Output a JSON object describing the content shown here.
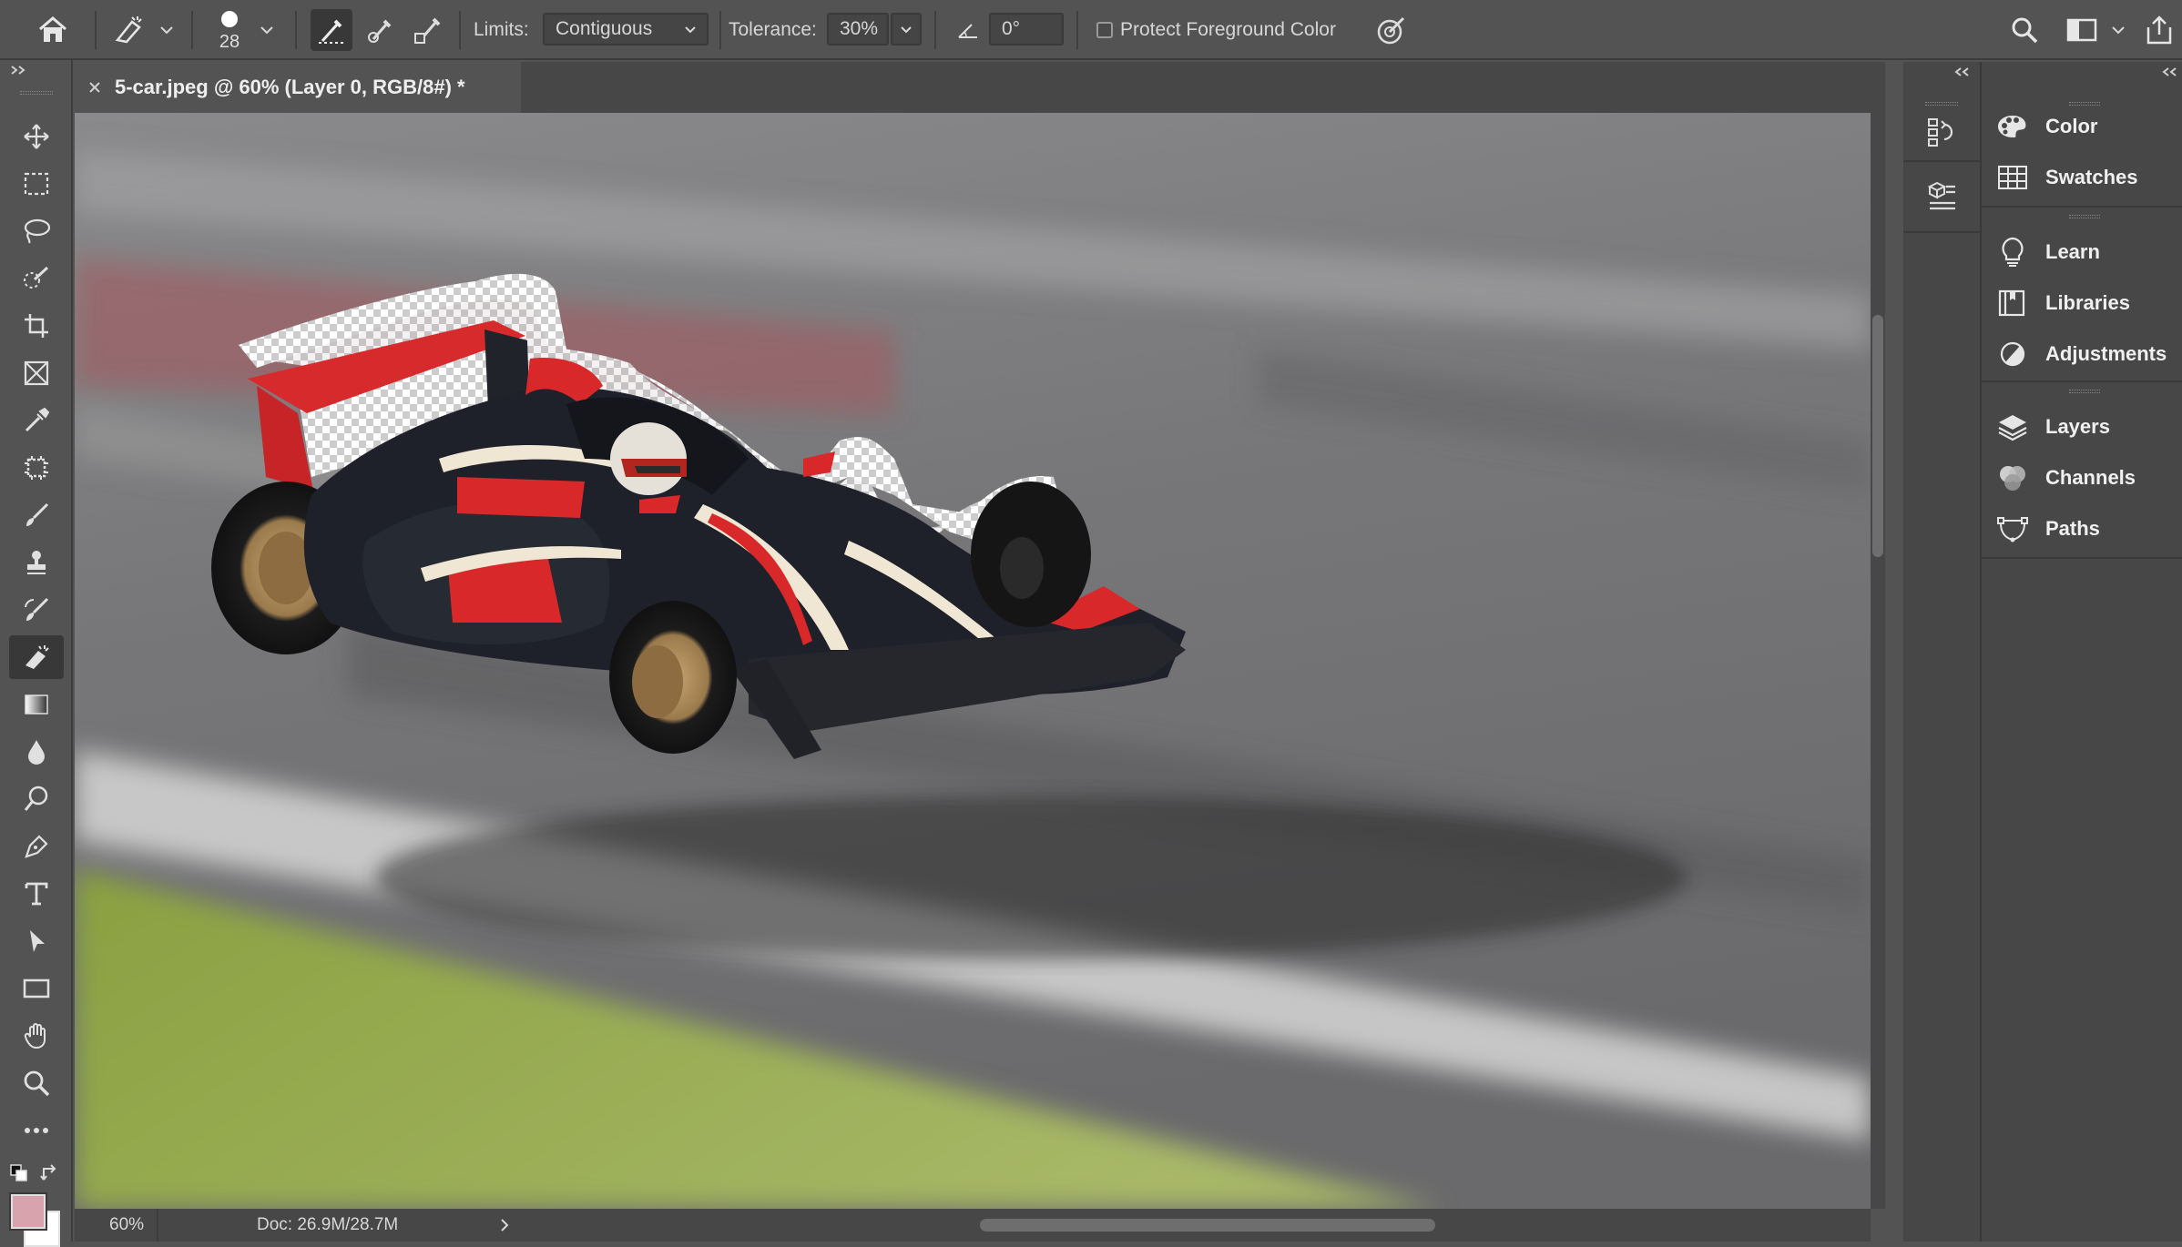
{
  "options_bar": {
    "brush_size": "28",
    "limits_label": "Limits:",
    "limits_value": "Contiguous",
    "tolerance_label": "Tolerance:",
    "tolerance_value": "30%",
    "angle_value": "0°",
    "protect_label": "Protect Foreground Color",
    "protect_checked": false,
    "icons": [
      "home-icon",
      "background-eraser-icon",
      "brush-preset-icon",
      "sampling-continuous-icon",
      "sampling-once-icon",
      "sampling-background-swatch-icon",
      "angle-icon",
      "pressure-icon",
      "search-icon",
      "workspace-icon",
      "share-icon"
    ]
  },
  "document": {
    "tab_title": "5-car.jpeg @ 60% (Layer 0, RGB/8#) *",
    "zoom": "60%",
    "doc_info": "Doc: 26.9M/28.7M"
  },
  "toolbar": {
    "tools": [
      "move-tool",
      "marquee-tool",
      "lasso-tool",
      "quick-selection-tool",
      "crop-tool",
      "frame-tool",
      "eyedropper-tool",
      "patch-tool",
      "brush-tool",
      "clone-stamp-tool",
      "history-brush-tool",
      "background-eraser-tool",
      "gradient-tool",
      "blur-tool",
      "dodge-tool",
      "pen-tool",
      "type-tool",
      "path-selection-tool",
      "rectangle-tool",
      "hand-tool",
      "zoom-tool",
      "more-tools"
    ],
    "active_tool": "background-eraser-tool",
    "foreground_color": "#d9a3ad",
    "background_color": "#ffffff"
  },
  "panels": {
    "groups": [
      [
        {
          "label": "Color",
          "icon": "color-palette-icon"
        },
        {
          "label": "Swatches",
          "icon": "swatches-grid-icon"
        }
      ],
      [
        {
          "label": "Learn",
          "icon": "lightbulb-icon"
        },
        {
          "label": "Libraries",
          "icon": "libraries-icon"
        },
        {
          "label": "Adjustments",
          "icon": "adjustments-icon"
        }
      ],
      [
        {
          "label": "Layers",
          "icon": "layers-icon"
        },
        {
          "label": "Channels",
          "icon": "channels-icon"
        },
        {
          "label": "Paths",
          "icon": "paths-icon"
        }
      ]
    ]
  },
  "colors": {
    "ui_background": "#535353",
    "panel_background": "#474747",
    "car_red": "#d8282a",
    "car_black": "#1c1f26"
  }
}
